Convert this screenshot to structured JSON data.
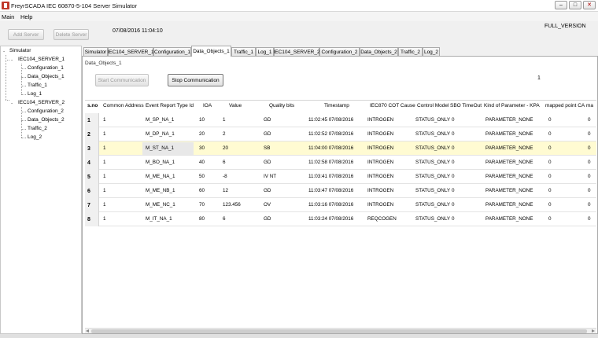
{
  "window": {
    "title": "FreyrSCADA IEC 60870-5-104 Server Simulator",
    "min_glyph": "–",
    "max_glyph": "□",
    "close_glyph": "✕"
  },
  "menu": {
    "main": "Main",
    "help": "Help"
  },
  "toolbar": {
    "add_server": "Add Server",
    "delete_server": "Delete Server",
    "datetime": "07/08/2016 11:04:10",
    "version": "FULL_VERSION"
  },
  "tree": {
    "root": "Simulator",
    "expand_glyph": "-",
    "servers": [
      {
        "label": "IEC104_SERVER_1",
        "children": [
          "Configuration_1",
          "Data_Objects_1",
          "Traffic_1",
          "Log_1"
        ]
      },
      {
        "label": "IEC104_SERVER_2",
        "children": [
          "Configuration_2",
          "Data_Objects_2",
          "Traffic_2",
          "Log_2"
        ]
      }
    ]
  },
  "tabs": [
    {
      "label": "Simulator"
    },
    {
      "label": "IEC104_SERVER_1"
    },
    {
      "label": "Configuration_1"
    },
    {
      "label": "Data_Objects_1",
      "active": true
    },
    {
      "label": "Traffic_1"
    },
    {
      "label": "Log_1"
    },
    {
      "label": "IEC104_SERVER_2"
    },
    {
      "label": "Configuration_2"
    },
    {
      "label": "Data_Objects_2"
    },
    {
      "label": "Traffic_2"
    },
    {
      "label": "Log_2"
    }
  ],
  "panel": {
    "title": "Data_Objects_1",
    "start_comm": "Start Communication",
    "stop_comm": "Stop Communication",
    "page_count": "1"
  },
  "table": {
    "columns": [
      "s.no",
      "Common Address",
      "Event Report Type Id",
      "IOA",
      "Value",
      "Quality bits",
      "Timestamp",
      "IEC870 COT Cause",
      "Control Model",
      "SBO TimeOut",
      "Kind of Parameter - KPA",
      "mapped point CA",
      "ma"
    ],
    "rows": [
      [
        "1",
        "1",
        "M_SP_NA_1",
        "10",
        "1",
        "GD",
        "11:02:45 07/08/2016",
        "INTROGEN",
        "STATUS_ONLY",
        "0",
        "PARAMETER_NONE",
        "0",
        "0"
      ],
      [
        "2",
        "1",
        "M_DP_NA_1",
        "20",
        "2",
        "GD",
        "11:02:52 07/08/2016",
        "INTROGEN",
        "STATUS_ONLY",
        "0",
        "PARAMETER_NONE",
        "0",
        "0"
      ],
      [
        "3",
        "1",
        "M_ST_NA_1",
        "30",
        "20",
        "SB",
        "11:04:00 07/08/2016",
        "INTROGEN",
        "STATUS_ONLY",
        "0",
        "PARAMETER_NONE",
        "0",
        "0"
      ],
      [
        "4",
        "1",
        "M_BO_NA_1",
        "40",
        "6",
        "GD",
        "11:02:58 07/08/2016",
        "INTROGEN",
        "STATUS_ONLY",
        "0",
        "PARAMETER_NONE",
        "0",
        "0"
      ],
      [
        "5",
        "1",
        "M_ME_NA_1",
        "50",
        "-8",
        "IV NT",
        "11:03:41 07/08/2016",
        "INTROGEN",
        "STATUS_ONLY",
        "0",
        "PARAMETER_NONE",
        "0",
        "0"
      ],
      [
        "6",
        "1",
        "M_ME_NB_1",
        "60",
        "12",
        "GD",
        "11:03:47 07/08/2016",
        "INTROGEN",
        "STATUS_ONLY",
        "0",
        "PARAMETER_NONE",
        "0",
        "0"
      ],
      [
        "7",
        "1",
        "M_ME_NC_1",
        "70",
        "123.456",
        "OV",
        "11:03:16 07/08/2016",
        "INTROGEN",
        "STATUS_ONLY",
        "0",
        "PARAMETER_NONE",
        "0",
        "0"
      ],
      [
        "8",
        "1",
        "M_IT_NA_1",
        "80",
        "6",
        "GD",
        "11:03:24 07/08/2016",
        "REQCOGEN",
        "STATUS_ONLY",
        "0",
        "PARAMETER_NONE",
        "0",
        "0"
      ]
    ],
    "selected_row": 3,
    "selected_row_color": "#fffbd2"
  }
}
